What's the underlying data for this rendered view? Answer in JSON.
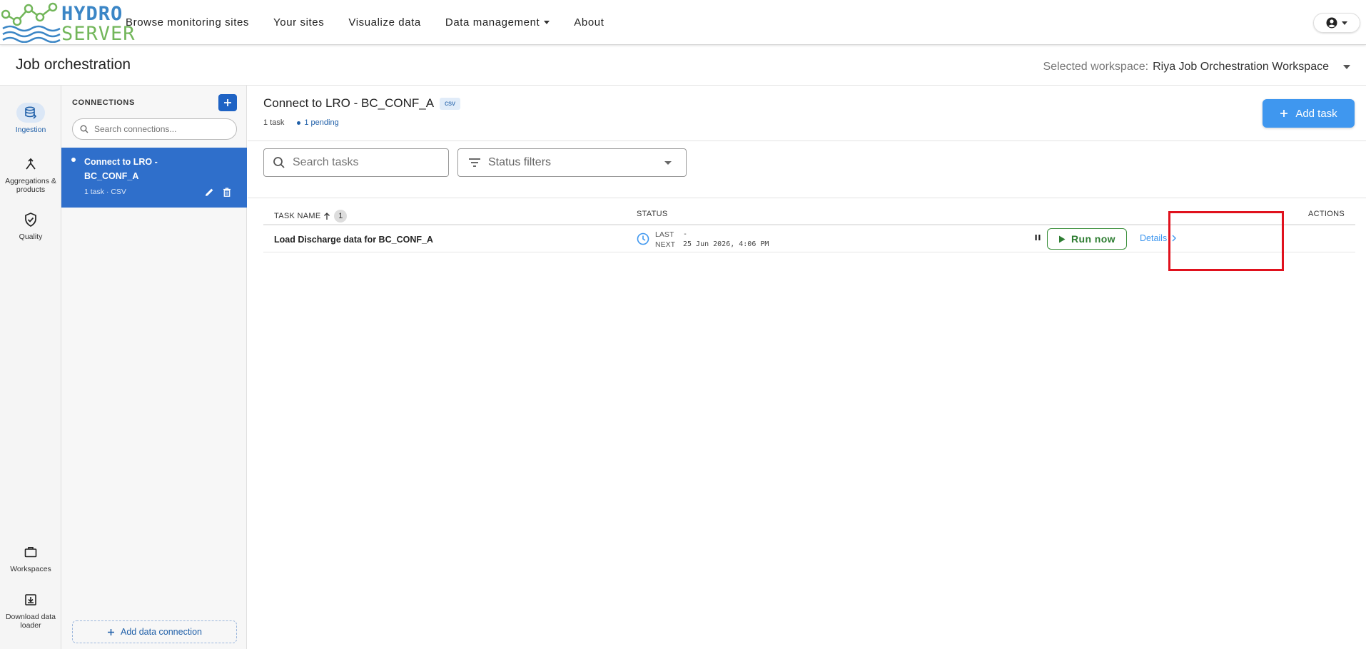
{
  "app": {
    "logo_line1": "HYDRO",
    "logo_line2": "SERVER"
  },
  "nav": {
    "items": [
      {
        "label": "Browse monitoring sites"
      },
      {
        "label": "Your sites"
      },
      {
        "label": "Visualize data"
      },
      {
        "label": "Data management"
      },
      {
        "label": "About"
      }
    ]
  },
  "page": {
    "title": "Job orchestration",
    "workspace_label": "Selected workspace:",
    "workspace_value": "Riya Job Orchestration Workspace"
  },
  "rail": {
    "items": [
      {
        "label": "Ingestion",
        "icon": "database-import-icon"
      },
      {
        "label": "Aggregations & products",
        "icon": "merge-icon"
      },
      {
        "label": "Quality",
        "icon": "shield-check-icon"
      },
      {
        "label": "Workspaces",
        "icon": "briefcase-icon"
      },
      {
        "label": "Download data loader",
        "icon": "download-box-icon"
      }
    ]
  },
  "connections": {
    "title": "CONNECTIONS",
    "search_placeholder": "Search connections...",
    "selected": {
      "name": "Connect to LRO - BC_CONF_A",
      "meta": "1 task · CSV"
    },
    "add_label": "Add data connection"
  },
  "main": {
    "connection_title": "Connect to LRO - BC_CONF_A",
    "badge": "csv",
    "task_count": "1 task",
    "pending": "1 pending",
    "add_task_label": "Add task",
    "search_placeholder": "Search tasks",
    "status_filter_label": "Status filters"
  },
  "table": {
    "headers": {
      "name": "TASK NAME",
      "sort_index": "1",
      "status": "STATUS",
      "actions": "ACTIONS"
    },
    "rows": [
      {
        "name": "Load Discharge data for BC_CONF_A",
        "last_key": "LAST",
        "last_val": "-",
        "next_key": "NEXT",
        "next_val": "25 Jun 2026, 4:06 PM",
        "run_label": "Run now",
        "details_label": "Details"
      }
    ]
  },
  "colors": {
    "primary": "#2f6fcb",
    "accent": "#3f97ef",
    "run_green": "#2e7d32",
    "highlight": "#e0111d"
  }
}
